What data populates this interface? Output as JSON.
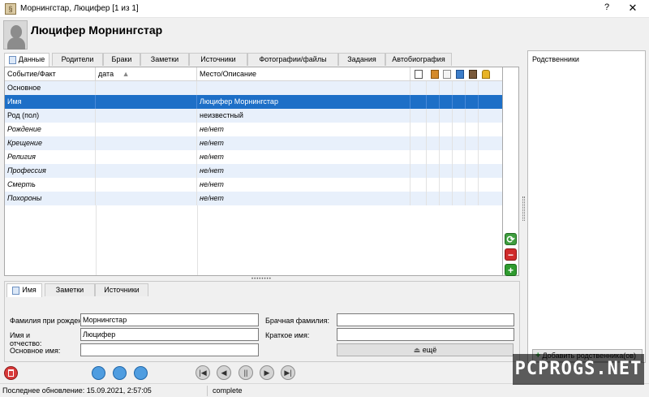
{
  "window": {
    "title": "Морнингстар, Люцифер [1 из 1]",
    "help": "?",
    "close": "✕"
  },
  "person": {
    "name": "Люцифер Морнингстар"
  },
  "tabs": [
    "Данные",
    "Родители",
    "Браки",
    "Заметки",
    "Источники",
    "Фотографии/файлы",
    "Задания",
    "Автобиография"
  ],
  "grid": {
    "headers": {
      "event": "Событие/Факт",
      "date": "дата",
      "place": "Место/Описание",
      "sort_indicator": "▲"
    },
    "rows": [
      {
        "event": "Основное",
        "date": "",
        "place": "",
        "italic": false
      },
      {
        "event": "Имя",
        "date": "",
        "place": "Люцифер Морнингстар",
        "italic": false,
        "selected": true
      },
      {
        "event": "Род (пол)",
        "date": "",
        "place": "неизвестный",
        "italic": false
      },
      {
        "event": "Рождение",
        "date": "",
        "place": "не/нет",
        "italic": true
      },
      {
        "event": "Крещение",
        "date": "",
        "place": "не/нет",
        "italic": true
      },
      {
        "event": "Религия",
        "date": "",
        "place": "не/нет",
        "italic": true
      },
      {
        "event": "Профессия",
        "date": "",
        "place": "не/нет",
        "italic": true
      },
      {
        "event": "Смерть",
        "date": "",
        "place": "не/нет",
        "italic": true
      },
      {
        "event": "Похороны",
        "date": "",
        "place": "не/нет",
        "italic": true
      }
    ]
  },
  "lower_tabs": [
    "Имя",
    "Заметки",
    "Источники"
  ],
  "name_form": {
    "surname_label": "Фамилия при рожден",
    "surname_value": "Морнингстар",
    "given_label": "Имя и",
    "given_label2": "отчество:",
    "given_value": "Люцифер",
    "main_name_label": "Основное имя:",
    "main_name_value": "",
    "married_label": "Брачная фамилия:",
    "married_value": "",
    "short_label": "Краткое имя:",
    "short_value": "",
    "more_button": "ещё"
  },
  "relatives": {
    "title": "Родственники",
    "add_button": "Добавить родственника(ов)"
  },
  "status": {
    "last_update": "Последнее обновление: 15.09.2021, 2:57:05",
    "state": "complete"
  },
  "watermark": "PCPROGS.NET",
  "colors": {
    "selection": "#1d6fc7",
    "alt_row": "#e8f0fb"
  }
}
